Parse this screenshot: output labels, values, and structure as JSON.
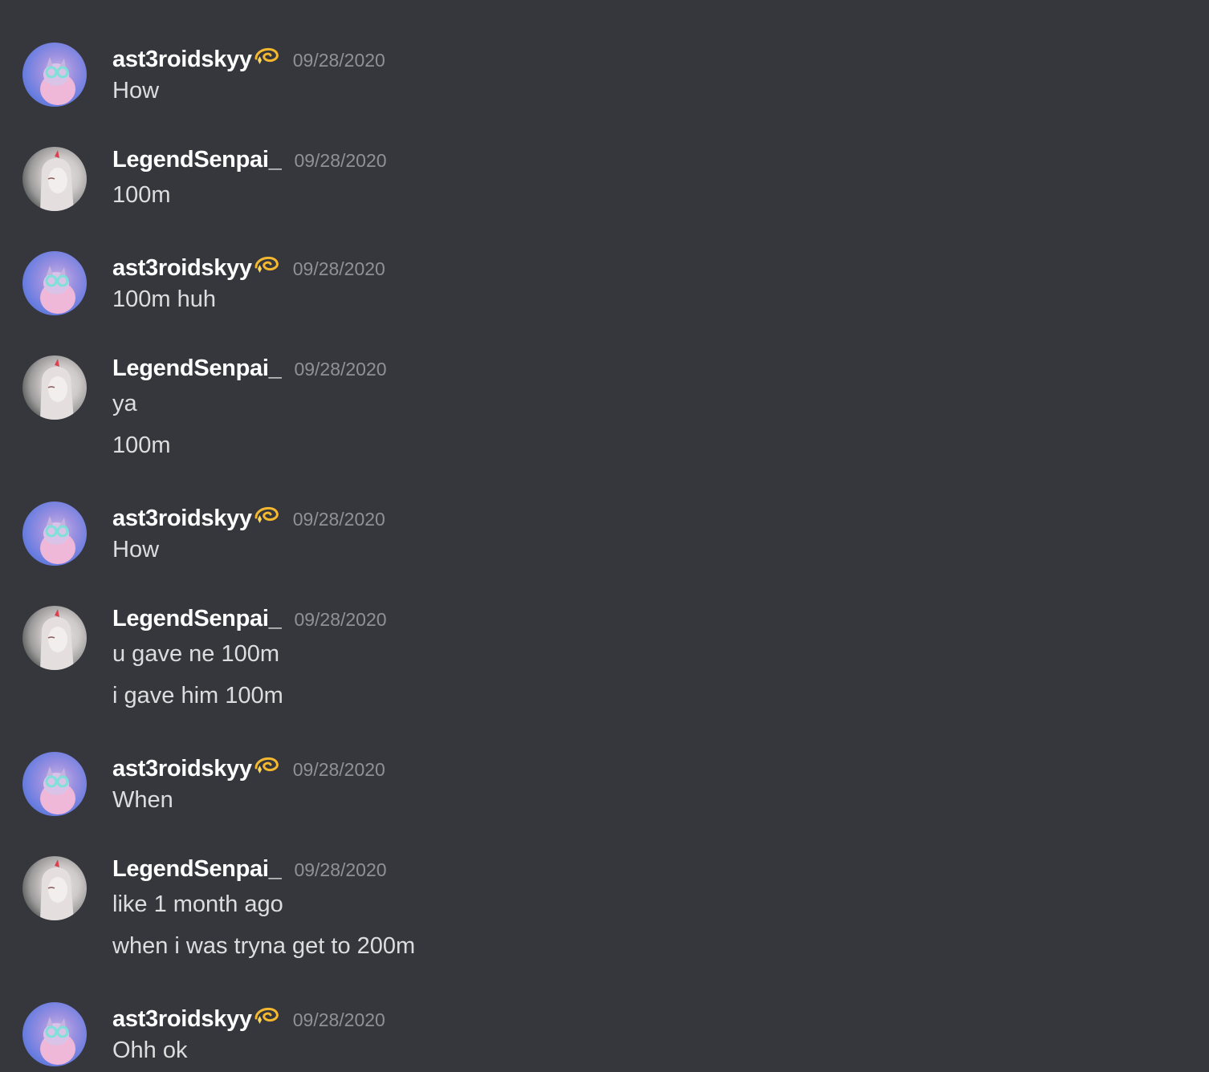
{
  "users": {
    "a": {
      "name": "ast3roidskyy",
      "badge": "dizzy-emoji-icon"
    },
    "b": {
      "name": "LegendSenpai_"
    }
  },
  "messages": [
    {
      "user": "a",
      "author": "ast3roidskyy",
      "timestamp": "09/28/2020",
      "lines": [
        "How"
      ]
    },
    {
      "user": "b",
      "author": "LegendSenpai_",
      "timestamp": "09/28/2020",
      "lines": [
        "100m"
      ]
    },
    {
      "user": "a",
      "author": "ast3roidskyy",
      "timestamp": "09/28/2020",
      "lines": [
        "100m huh"
      ]
    },
    {
      "user": "b",
      "author": "LegendSenpai_",
      "timestamp": "09/28/2020",
      "lines": [
        "ya",
        "100m"
      ]
    },
    {
      "user": "a",
      "author": "ast3roidskyy",
      "timestamp": "09/28/2020",
      "lines": [
        "How"
      ]
    },
    {
      "user": "b",
      "author": "LegendSenpai_",
      "timestamp": "09/28/2020",
      "lines": [
        "u gave ne 100m",
        "i gave him 100m"
      ]
    },
    {
      "user": "a",
      "author": "ast3roidskyy",
      "timestamp": "09/28/2020",
      "lines": [
        "When"
      ]
    },
    {
      "user": "b",
      "author": "LegendSenpai_",
      "timestamp": "09/28/2020",
      "lines": [
        "like 1 month ago",
        "when i was tryna get to 200m"
      ]
    },
    {
      "user": "a",
      "author": "ast3roidskyy",
      "timestamp": "09/28/2020",
      "lines": [
        "Ohh ok"
      ]
    }
  ],
  "colors": {
    "background": "#36373d",
    "username": "#ffffff",
    "timestamp": "#8e9297",
    "text": "#dcddde"
  }
}
